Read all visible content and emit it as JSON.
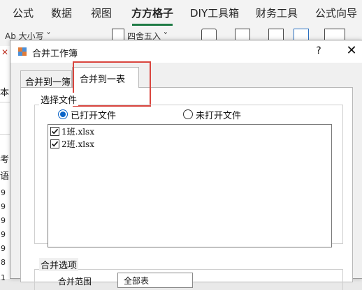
{
  "ribbon": {
    "tabs": [
      "公式",
      "数据",
      "视图",
      "方方格子",
      "DIY工具箱",
      "财务工具",
      "公式向导"
    ],
    "active_tab": "方方格子",
    "font_size_label": "Ab 大小写 ˅",
    "round_label": "四舍五入 ˅"
  },
  "sheet_strip": {
    "chars": [
      "本",
      "考",
      "语"
    ],
    "rows": [
      "9",
      "9",
      "9",
      "9",
      "9",
      "8",
      "1"
    ]
  },
  "dialog": {
    "title": "合并工作簿",
    "help": "?",
    "close": "✕",
    "tabs": [
      "合并到一簿",
      "合并到一表"
    ],
    "active_tab": "合并到一表",
    "select_files_legend": "选择文件",
    "radio_opened": "已打开文件",
    "radio_unopened": "未打开文件",
    "files": [
      {
        "name": "1班.xlsx",
        "checked": true
      },
      {
        "name": "2班.xlsx",
        "checked": true
      }
    ],
    "merge_options_legend": "合并选项",
    "range_label": "合并范围",
    "range_value": "全部表"
  },
  "colors": {
    "accent": "#1f7b45",
    "highlight": "#d9453e",
    "radio": "#0a64c8"
  }
}
